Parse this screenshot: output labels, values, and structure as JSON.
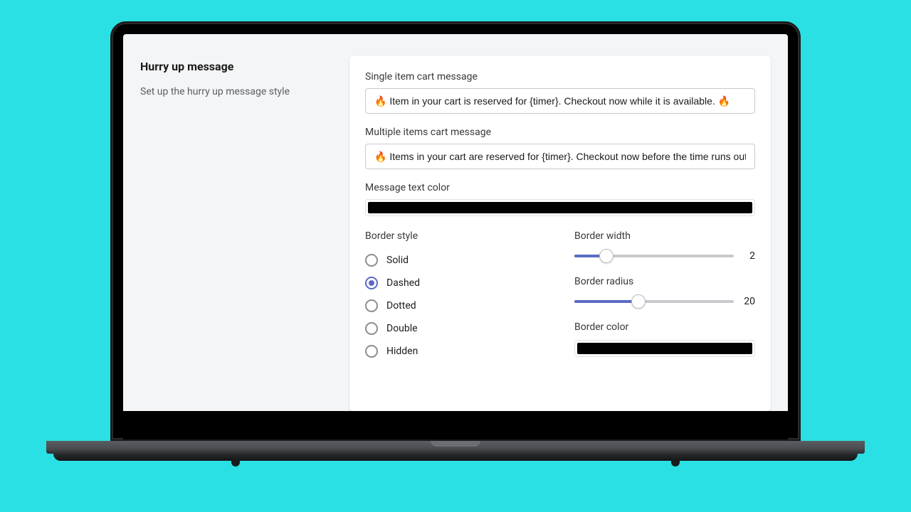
{
  "section": {
    "title": "Hurry up message",
    "description": "Set up the hurry up message style"
  },
  "fields": {
    "single_item_label": "Single item cart message",
    "single_item_value": "🔥 Item in your cart is reserved for {timer}. Checkout now while it is available. 🔥",
    "multi_item_label": "Multiple items cart message",
    "multi_item_value": "🔥 Items in your cart are reserved for {timer}. Checkout now before the time runs out. 🔥",
    "text_color_label": "Message text color",
    "text_color_value": "#000000"
  },
  "border": {
    "style_label": "Border style",
    "style_options": {
      "solid": "Solid",
      "dashed": "Dashed",
      "dotted": "Dotted",
      "double": "Double",
      "hidden": "Hidden"
    },
    "style_selected": "dashed",
    "width_label": "Border width",
    "width_value": "2",
    "width_max": 10,
    "radius_label": "Border radius",
    "radius_value": "20",
    "radius_max": 50,
    "color_label": "Border color",
    "color_value": "#000000"
  }
}
